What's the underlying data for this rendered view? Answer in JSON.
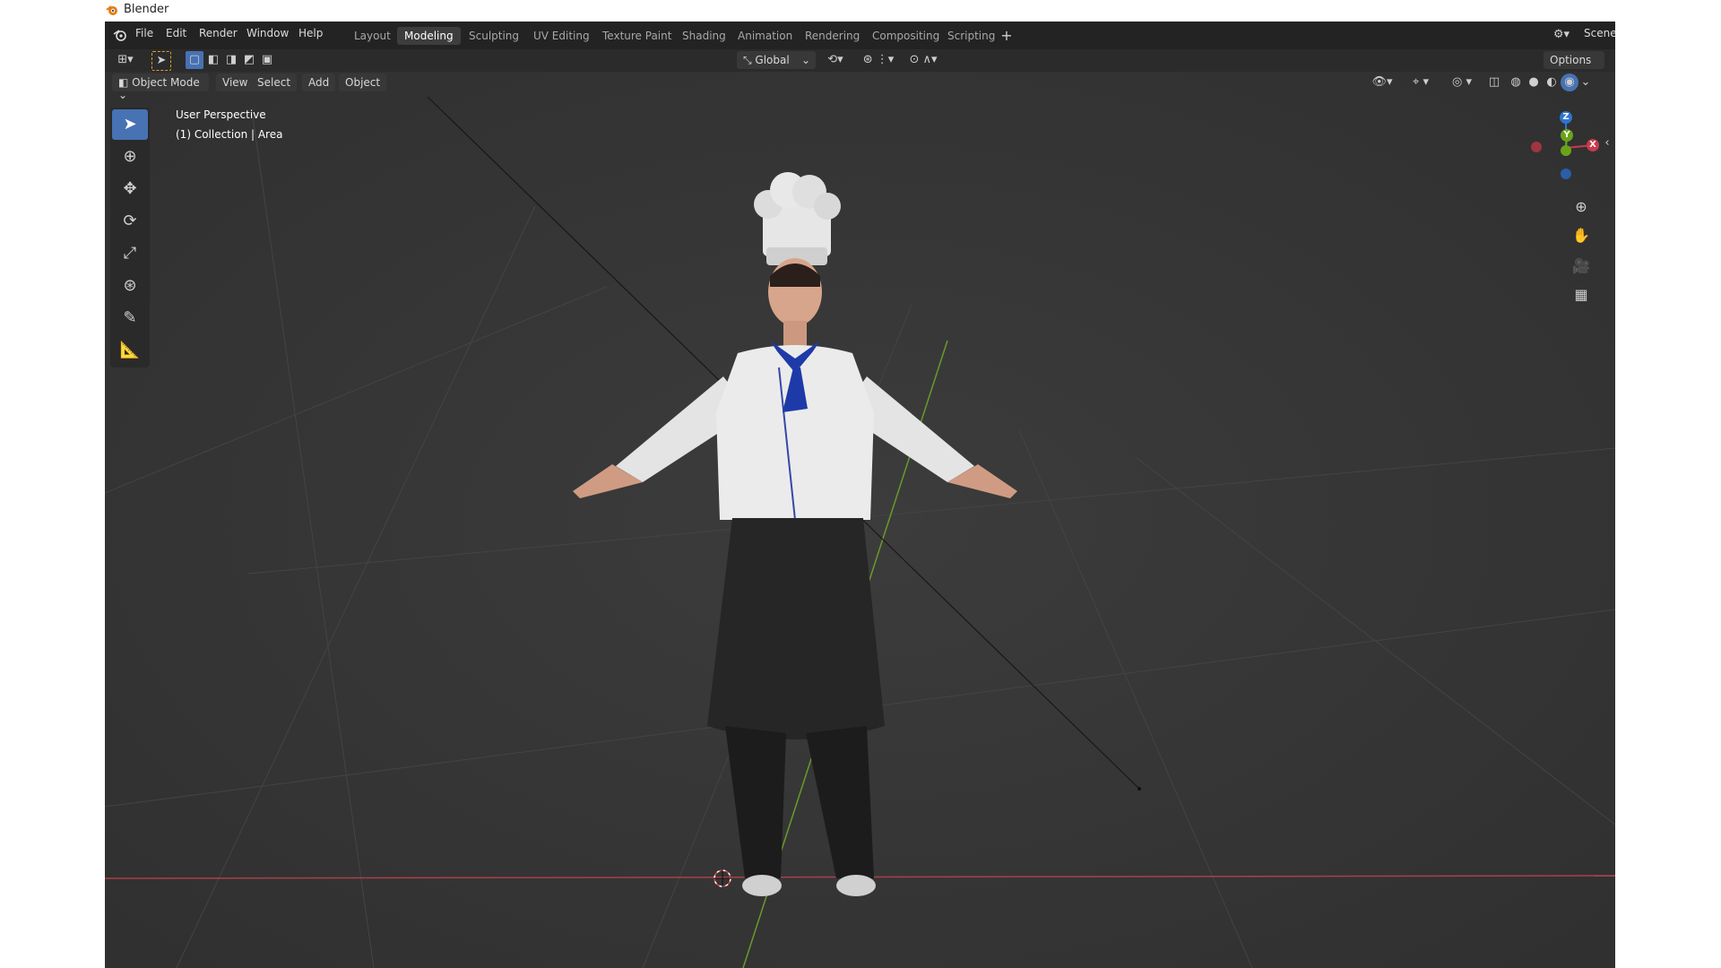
{
  "window": {
    "title": "Blender"
  },
  "menu": {
    "file": "File",
    "edit": "Edit",
    "render": "Render",
    "window": "Window",
    "help": "Help"
  },
  "workspaces": [
    "Layout",
    "Modeling",
    "Sculpting",
    "UV Editing",
    "Texture Paint",
    "Shading",
    "Animation",
    "Rendering",
    "Compositing",
    "Scripting"
  ],
  "active_workspace": "Modeling",
  "scene_label": "Scene",
  "tool_header": {
    "orientation": "Global",
    "options": "Options"
  },
  "view_header": {
    "mode": "Object Mode",
    "view": "View",
    "select": "Select",
    "add": "Add",
    "object": "Object"
  },
  "overlay": {
    "perspective": "User Perspective",
    "collection": "(1) Collection | Area"
  },
  "gizmo": {
    "x": "X",
    "y": "Y",
    "z": "Z"
  },
  "colors": {
    "active_tab": "#3d3d3d",
    "tool_active": "#4772b3",
    "x_axis": "#c83b4a",
    "y_axis": "#6aa318",
    "z_axis": "#2f74cf"
  }
}
